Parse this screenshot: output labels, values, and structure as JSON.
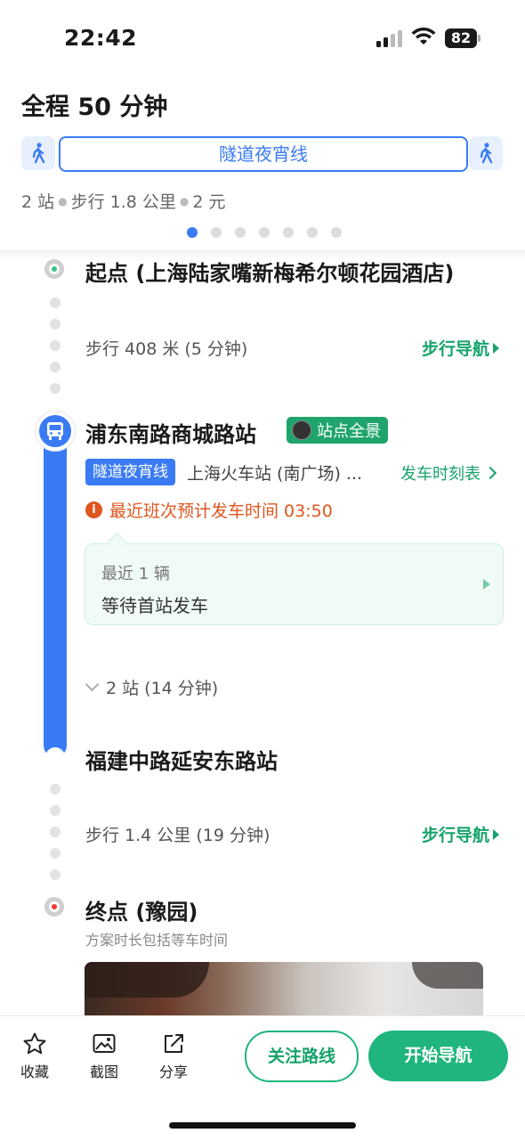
{
  "status_bar": {
    "time": "22:42",
    "battery": "82"
  },
  "header": {
    "title": "全程 50 分钟",
    "route_line": "隧道夜宵线",
    "summary_stops": "2 站",
    "summary_walk": "步行 1.8 公里",
    "summary_price": "2 元",
    "pages_total": 7,
    "page_active": 1
  },
  "timeline": {
    "start": {
      "name": "起点 (上海陆家嘴新梅希尔顿花园酒店)"
    },
    "walk1": {
      "text": "步行 408 米 (5 分钟)",
      "nav_label": "步行导航"
    },
    "board_stop": {
      "name": "浦东南路商城路站",
      "panorama_label": "站点全景",
      "line_tag": "隧道夜宵线",
      "direction": "上海火车站 (南广场) ...",
      "timetable_label": "发车时刻表",
      "warning": "最近班次预计发车时间 03:50",
      "card_line1": "最近 1 辆",
      "card_line2": "等待首站发车",
      "stops_count": "2 站 (14 分钟)"
    },
    "alight_stop": {
      "name": "福建中路延安东路站"
    },
    "walk2": {
      "text": "步行 1.4 公里 (19 分钟)",
      "nav_label": "步行导航"
    },
    "end": {
      "name": "终点 (豫园)",
      "note": "方案时长包括等车时间"
    }
  },
  "bottom_bar": {
    "collect": "收藏",
    "screenshot": "截图",
    "share": "分享",
    "follow": "关注路线",
    "start": "开始导航"
  },
  "colors": {
    "accent_blue": "#3a7bf5",
    "accent_green": "#1fb57c",
    "warning": "#e0551e"
  }
}
